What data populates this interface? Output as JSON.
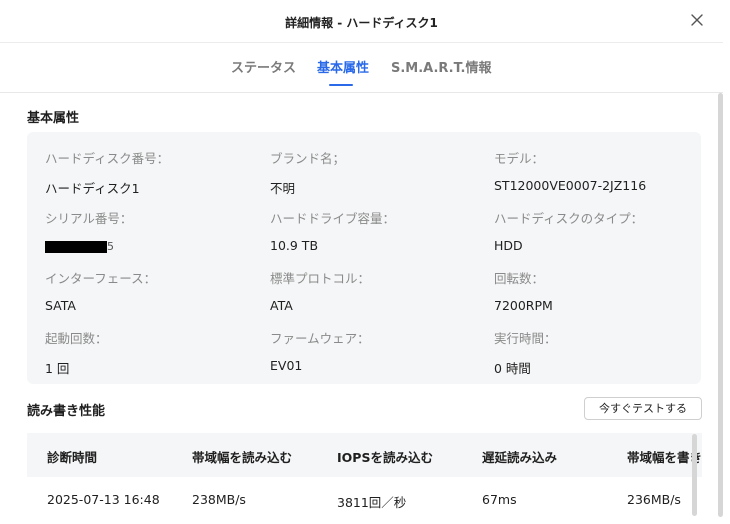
{
  "dialog": {
    "title": "詳細情報 - ハードディスク1"
  },
  "tabs": [
    {
      "label": "ステータス"
    },
    {
      "label": "基本属性"
    },
    {
      "label": "S.M.A.R.T.情報"
    }
  ],
  "basic": {
    "section_title": "基本属性",
    "attributes": [
      {
        "label": "ハードディスク番号：",
        "value": "ハードディスク1"
      },
      {
        "label": "ブランド名；",
        "value": "不明"
      },
      {
        "label": "モデル：",
        "value": "ST12000VE0007-2JZ116"
      },
      {
        "label": "シリアル番号：",
        "value": "5"
      },
      {
        "label": "ハードドライブ容量：",
        "value": "10.9 TB"
      },
      {
        "label": "ハードディスクのタイプ：",
        "value": "HDD"
      },
      {
        "label": "インターフェース：",
        "value": "SATA"
      },
      {
        "label": "標準プロトコル：",
        "value": "ATA"
      },
      {
        "label": "回転数：",
        "value": "7200RPM"
      },
      {
        "label": "起動回数：",
        "value": "1 回"
      },
      {
        "label": "ファームウェア：",
        "value": "EV01"
      },
      {
        "label": "実行時間：",
        "value": "0 時間"
      }
    ]
  },
  "perf": {
    "section_title": "読み書き性能",
    "test_button": "今すぐテストする",
    "columns": [
      "診断時間",
      "帯域幅を読み込む",
      "IOPSを読み込む",
      "遅延読み込み",
      "帯域幅を書き"
    ],
    "rows": [
      [
        "2025-07-13 16:48",
        "238MB/s",
        "3811回／秒",
        "67ms",
        "236MB/s"
      ]
    ]
  }
}
